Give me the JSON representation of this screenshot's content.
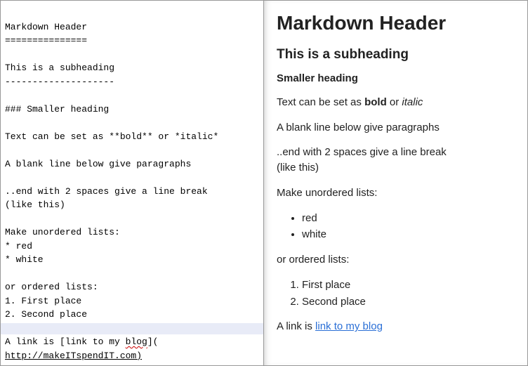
{
  "source": {
    "h1_text": "Markdown Header",
    "h1_underline": "===============",
    "h2_text": "This is a subheading",
    "h2_underline": "--------------------",
    "h3_line": "### Smaller heading",
    "style_line": "Text can be set as **bold** or *italic*",
    "para1": "A blank line below give paragraphs",
    "para2a": "..end with 2 spaces give a line break",
    "para2b": "(like this)",
    "ul_intro": "Make unordered lists:",
    "ul1": "* red",
    "ul2": "* white",
    "ol_intro": "or ordered lists:",
    "ol1": "1. First place",
    "ol2": "2. Second place",
    "link_pre": "A link is [link to my ",
    "link_blog_word": "blog",
    "link_post": "](",
    "link_url": "http://makeITspendIT.com)"
  },
  "rendered": {
    "h1": "Markdown Header",
    "h2": "This is a subheading",
    "h3": "Smaller heading",
    "style_pre": "Text can be set as ",
    "style_bold": "bold",
    "style_mid": " or ",
    "style_italic": "italic",
    "para1": "A blank line below give paragraphs",
    "para2a": "..end with 2 spaces give a line break",
    "para2b": "(like this)",
    "ul_intro": "Make unordered lists:",
    "ul_items": [
      "red",
      "white"
    ],
    "ol_intro": "or ordered lists:",
    "ol_items": [
      "First place",
      "Second place"
    ],
    "link_pre": "A link is ",
    "link_text": "link to my blog",
    "link_href": "http://makeITspendIT.com"
  }
}
